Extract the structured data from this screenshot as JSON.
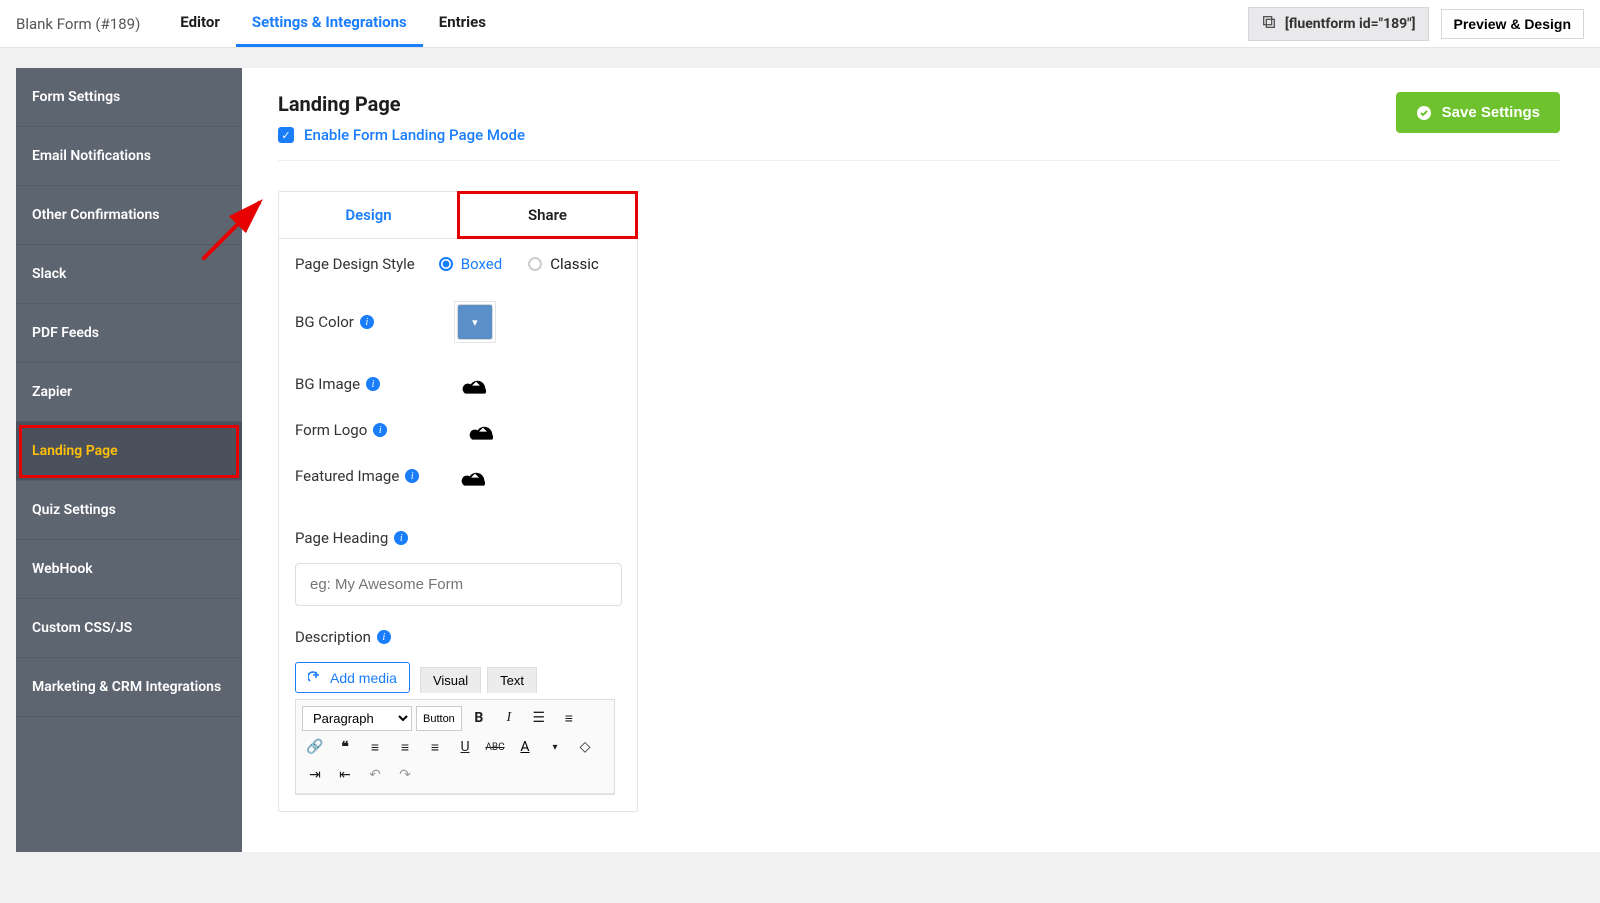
{
  "header": {
    "form_title": "Blank Form (#189)",
    "tabs": [
      "Editor",
      "Settings & Integrations",
      "Entries"
    ],
    "active_tab": 1,
    "shortcode": "[fluentform id=\"189\"]",
    "preview_btn": "Preview & Design"
  },
  "sidebar": {
    "items": [
      "Form Settings",
      "Email Notifications",
      "Other Confirmations",
      "Slack",
      "PDF Feeds",
      "Zapier",
      "Landing Page",
      "Quiz Settings",
      "WebHook",
      "Custom CSS/JS",
      "Marketing & CRM Integrations"
    ],
    "active_index": 6
  },
  "page": {
    "title": "Landing Page",
    "enable_label": "Enable Form Landing Page Mode",
    "enable_checked": true,
    "save_btn": "Save Settings"
  },
  "config": {
    "tabs": {
      "design": "Design",
      "share": "Share",
      "active": "design"
    },
    "style": {
      "label": "Page Design Style",
      "options": {
        "boxed": "Boxed",
        "classic": "Classic"
      },
      "selected": "boxed"
    },
    "bg_color_label": "BG Color",
    "bg_color_value": "#5b8fc7",
    "bg_image_label": "BG Image",
    "form_logo_label": "Form Logo",
    "featured_image_label": "Featured Image",
    "page_heading_label": "Page Heading",
    "page_heading_placeholder": "eg: My Awesome Form",
    "description_label": "Description",
    "add_media_label": "Add media",
    "editor_modes": {
      "visual": "Visual",
      "text": "Text"
    },
    "paragraph_label": "Paragraph",
    "button_label": "Button"
  }
}
